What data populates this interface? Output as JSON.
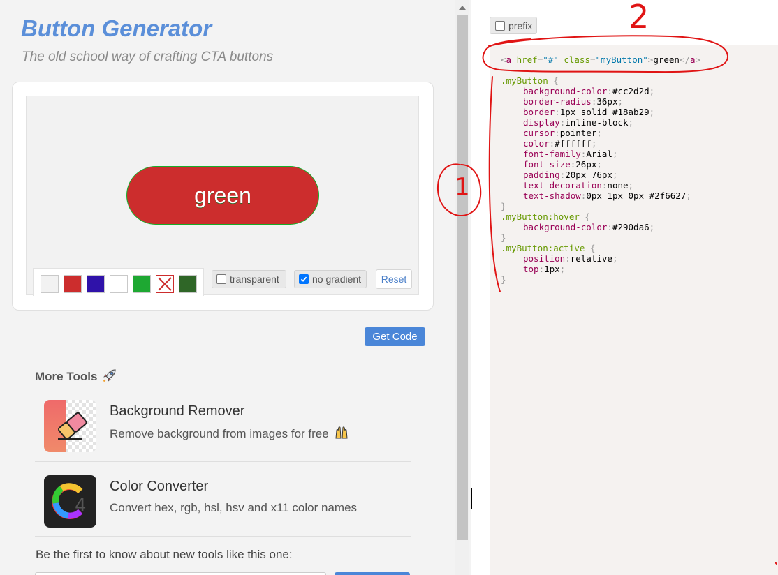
{
  "header": {
    "title": "Button Generator",
    "subtitle": "The old school way of crafting CTA buttons"
  },
  "preview": {
    "button_label": "green",
    "swatches": [
      {
        "color": "#f2f2f2",
        "name": "light-gray"
      },
      {
        "color": "#cc2d2d",
        "name": "red"
      },
      {
        "color": "#2f12a9",
        "name": "indigo"
      },
      {
        "color": "#ffffff",
        "name": "white"
      },
      {
        "color": "#1ea832",
        "name": "green"
      },
      {
        "color": "#ffffff",
        "name": "none-crossed"
      },
      {
        "color": "#2f6627",
        "name": "dark-green"
      }
    ],
    "transparent_label": "transparent",
    "transparent_checked": false,
    "no_gradient_label": "no gradient",
    "no_gradient_checked": true,
    "reset_label": "Reset"
  },
  "get_code_label": "Get Code",
  "more_tools": {
    "title": "More Tools",
    "title_icon": "rocket-icon",
    "items": [
      {
        "name": "Background Remover",
        "desc": "Remove background from images for free",
        "icon": "eraser-icon"
      },
      {
        "name": "Color Converter",
        "desc": "Convert hex, rgb, hsl, hsv and x11 color names",
        "icon": "color-wheel-icon"
      }
    ]
  },
  "newsletter": {
    "text": "Be the first to know about new tools like this one:"
  },
  "code_panel": {
    "prefix_label": "prefix",
    "prefix_checked": false,
    "html_line": [
      {
        "t": "<",
        "c": "p"
      },
      {
        "t": "a ",
        "c": "tag"
      },
      {
        "t": "href",
        "c": "attr"
      },
      {
        "t": "=",
        "c": "p"
      },
      {
        "t": "\"#\"",
        "c": "str"
      },
      {
        "t": " ",
        "c": "p"
      },
      {
        "t": "class",
        "c": "attr"
      },
      {
        "t": "=",
        "c": "p"
      },
      {
        "t": "\"myButton\"",
        "c": "str"
      },
      {
        "t": ">",
        "c": "p"
      },
      {
        "t": "green",
        "c": "txt"
      },
      {
        "t": "</",
        "c": "p"
      },
      {
        "t": "a",
        "c": "tag"
      },
      {
        "t": ">",
        "c": "p"
      }
    ],
    "css_blocks": [
      {
        "selector": ".myButton",
        "props": [
          [
            "background-color",
            "#cc2d2d"
          ],
          [
            "border-radius",
            "36px"
          ],
          [
            "border",
            "1px solid #18ab29"
          ],
          [
            "display",
            "inline-block"
          ],
          [
            "cursor",
            "pointer"
          ],
          [
            "color",
            "#ffffff"
          ],
          [
            "font-family",
            "Arial"
          ],
          [
            "font-size",
            "26px"
          ],
          [
            "padding",
            "20px 76px"
          ],
          [
            "text-decoration",
            "none"
          ],
          [
            "text-shadow",
            "0px 1px 0px #2f6627"
          ]
        ]
      },
      {
        "selector": ".myButton:hover",
        "props": [
          [
            "background-color",
            "#290da6"
          ]
        ]
      },
      {
        "selector": ".myButton:active",
        "props": [
          [
            "position",
            "relative"
          ],
          [
            "top",
            "1px"
          ]
        ]
      }
    ]
  },
  "annotations": {
    "label_1": "1",
    "label_2": "2",
    "color": "#e01414"
  },
  "colors": {
    "accent": "#4a86d8",
    "title": "#5b8fd9",
    "code_tag": "#905",
    "code_attr": "#690",
    "code_str": "#07a",
    "code_punct": "#999"
  }
}
